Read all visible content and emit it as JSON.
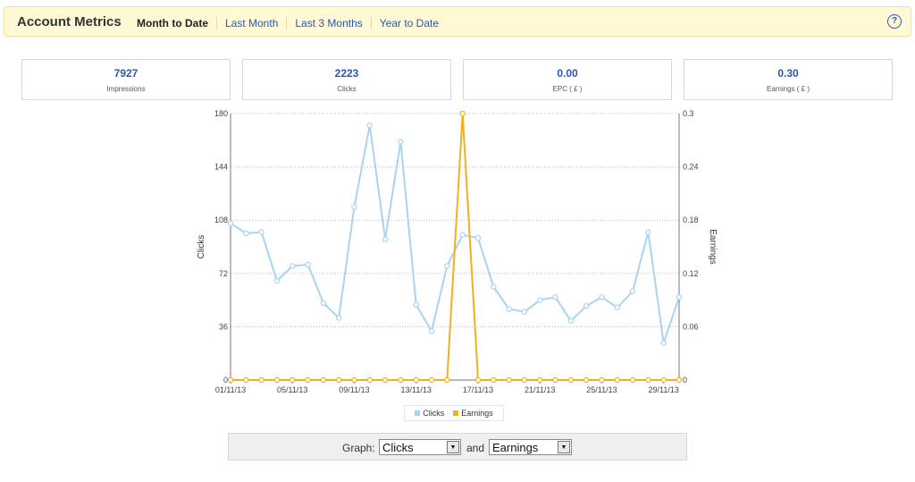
{
  "header": {
    "title": "Account Metrics",
    "tabs": [
      {
        "label": "Month to Date",
        "active": true
      },
      {
        "label": "Last Month",
        "active": false
      },
      {
        "label": "Last 3 Months",
        "active": false
      },
      {
        "label": "Year to Date",
        "active": false
      }
    ],
    "help_icon": "question-circle-icon"
  },
  "cards": [
    {
      "value": "7927",
      "label": "Impressions"
    },
    {
      "value": "2223",
      "label": "Clicks"
    },
    {
      "value": "0.00",
      "label": "EPC ( £ )"
    },
    {
      "value": "0.30",
      "label": "Earnings ( £ )"
    }
  ],
  "chart_data": {
    "type": "line",
    "x": [
      "01/11/13",
      "02/11/13",
      "03/11/13",
      "04/11/13",
      "05/11/13",
      "06/11/13",
      "07/11/13",
      "08/11/13",
      "09/11/13",
      "10/11/13",
      "11/11/13",
      "12/11/13",
      "13/11/13",
      "14/11/13",
      "15/11/13",
      "16/11/13",
      "17/11/13",
      "18/11/13",
      "19/11/13",
      "20/11/13",
      "21/11/13",
      "22/11/13",
      "23/11/13",
      "24/11/13",
      "25/11/13",
      "26/11/13",
      "27/11/13",
      "28/11/13",
      "29/11/13",
      "30/11/13"
    ],
    "x_tick_labels": [
      "01/11/13",
      "05/11/13",
      "09/11/13",
      "13/11/13",
      "17/11/13",
      "21/11/13",
      "25/11/13",
      "29/11/13"
    ],
    "series": [
      {
        "name": "Clicks",
        "axis": "left",
        "color": "#a9d3f0",
        "values": [
          106,
          99,
          100,
          67,
          77,
          78,
          52,
          42,
          117,
          172,
          95,
          161,
          51,
          33,
          77,
          98,
          96,
          63,
          48,
          46,
          54,
          56,
          40,
          50,
          56,
          49,
          60,
          100,
          25,
          56
        ]
      },
      {
        "name": "Earnings",
        "axis": "right",
        "color": "#f2b01e",
        "values": [
          0,
          0,
          0,
          0,
          0,
          0,
          0,
          0,
          0,
          0,
          0,
          0,
          0,
          0,
          0,
          0.3,
          0,
          0,
          0,
          0,
          0,
          0,
          0,
          0,
          0,
          0,
          0,
          0,
          0,
          0
        ]
      }
    ],
    "ylabel_left": "Clicks",
    "ylabel_right": "Earnings",
    "ylim_left": [
      0,
      180
    ],
    "ylim_right": [
      0,
      0.3
    ],
    "yticks_left": [
      "0",
      "36",
      "72",
      "108",
      "144",
      "180"
    ],
    "yticks_right": [
      "0",
      "0.06",
      "0.12",
      "0.18",
      "0.24",
      "0.3"
    ],
    "grid": true,
    "legend": "bottom-center"
  },
  "legend": {
    "items": [
      "Clicks",
      "Earnings"
    ]
  },
  "graph_controls": {
    "label": "Graph:",
    "first_value": "Clicks",
    "and_label": "and",
    "second_value": "Earnings"
  }
}
